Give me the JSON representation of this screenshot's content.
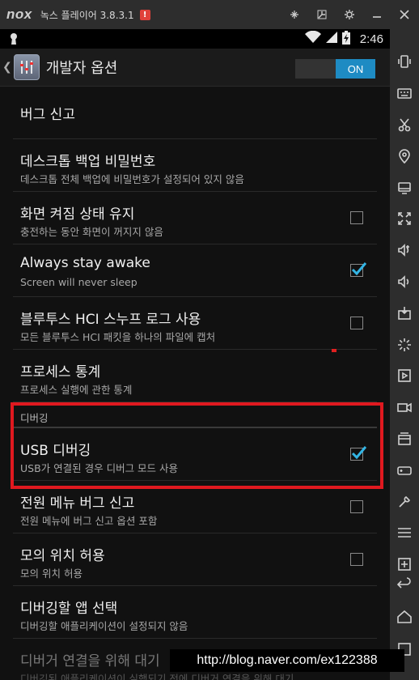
{
  "window": {
    "logo": "nox",
    "title": "녹스 플레이어 3.8.3.1",
    "alert": "!",
    "controls": [
      "pin-icon",
      "restore-icon",
      "settings-icon",
      "minimize-icon",
      "close-icon"
    ]
  },
  "statusbar": {
    "time": "2:46"
  },
  "actionbar": {
    "title": "개발자 옵션",
    "toggle_label": "ON",
    "toggle_state": "on"
  },
  "settings": [
    {
      "title": "버그 신고"
    },
    {
      "title": "데스크톱 백업 비밀번호",
      "summary": "데스크톱 전체 백업에 비밀번호가 설정되어 있지 않음"
    },
    {
      "title": "화면 켜짐 상태 유지",
      "summary": "충전하는 동안 화면이 꺼지지 않음",
      "checked": false
    },
    {
      "title": "Always stay awake",
      "summary": "Screen will never sleep",
      "checked": true
    },
    {
      "title": "블루투스 HCI 스누프 로그 사용",
      "summary": "모든 블루투스 HCI 패킷을 하나의 파일에 캡처",
      "checked": false
    },
    {
      "title": "프로세스 통계",
      "summary": "프로세스 실행에 관한 통계"
    }
  ],
  "debug_section": {
    "header": "디버깅",
    "items": [
      {
        "title": "USB 디버깅",
        "summary": "USB가 연결된 경우 디버그 모드 사용",
        "checked": true
      },
      {
        "title": "전원 메뉴 버그 신고",
        "summary": "전원 메뉴에 버그 신고 옵션 포함",
        "checked": false
      },
      {
        "title": "모의 위치 허용",
        "summary": "모의 위치 허용",
        "checked": false
      },
      {
        "title": "디버깅할 앱 선택",
        "summary": "디버깅할 애플리케이션이 설정되지 않음"
      },
      {
        "title": "디버거 연결을 위해 대기",
        "summary": "디버깅된 애플리케이션이 실행되기 전에 디버거 연결을 위해 대기"
      }
    ]
  },
  "watermark": "http://blog.naver.com/ex122388",
  "sidebar_icons": [
    "shake-icon",
    "keyboard-icon",
    "scissors-icon",
    "location-icon",
    "screen-icon",
    "fullscreen-icon",
    "volume-up-icon",
    "volume-down-icon",
    "apk-install-icon",
    "loading-icon",
    "macro-icon",
    "video-record-icon",
    "multi-instance-icon",
    "gamepad-icon",
    "tools-icon",
    "menu-icon",
    "add-icon",
    "back-icon",
    "home-icon",
    "recent-apps-icon"
  ],
  "colors": {
    "accent": "#1e8bc3",
    "highlight": "#e0191f",
    "background": "#111111"
  }
}
